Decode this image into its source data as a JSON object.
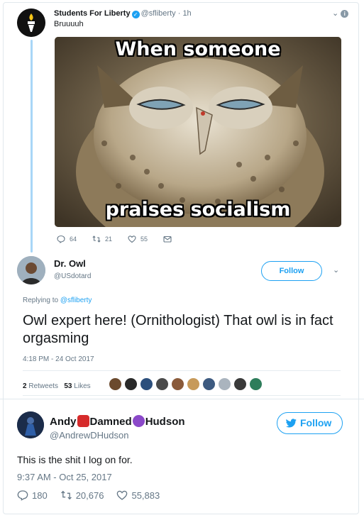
{
  "colors": {
    "accent": "#1da1f2",
    "muted": "#657786",
    "thread_line": "#a8d6f7",
    "text": "#14171a"
  },
  "tweet1": {
    "display_name": "Students For Liberty",
    "handle": "@sfliberty",
    "time_sep": "·",
    "time": "1h",
    "text": "Bruuuuh",
    "meme": {
      "top_caption": "When someone",
      "bottom_caption": "praises socialism"
    },
    "reply_count": "64",
    "retweet_count": "21",
    "like_count": "55",
    "icons": [
      "chevron-down-icon",
      "info-icon",
      "reply-icon",
      "retweet-icon",
      "heart-icon",
      "dm-icon"
    ]
  },
  "reply": {
    "display_name": "Dr. Owl",
    "handle": "@USdotard",
    "follow_label": "Follow",
    "replying_prefix": "Replying to",
    "replying_to": "@sfliberty",
    "text": "Owl expert here!  (Ornithologist) That owl is in fact orgasming",
    "timestamp": "4:18 PM - 24 Oct 2017",
    "retweets_value": "2",
    "retweets_label": "Retweets",
    "likes_value": "53",
    "likes_label": "Likes",
    "liker_colors": [
      "#6b4a2e",
      "#2a2a2a",
      "#2c4f7c",
      "#4a4a4a",
      "#8a5a3a",
      "#c79a5a",
      "#3d5a80",
      "#aab4be",
      "#3a3a3a",
      "#2e7d5b"
    ]
  },
  "tweet2": {
    "name_part1": "Andy",
    "name_part2": "Damned",
    "name_part3": "Hudson",
    "handle": "@AndrewDHudson",
    "follow_label": "Follow",
    "text": "This is the shit I log on for.",
    "timestamp": "9:37 AM - Oct 25, 2017",
    "reply_count": "180",
    "retweet_count": "20,676",
    "like_count": "55,883",
    "icons": [
      "ogre-emoji-icon",
      "devil-emoji-icon",
      "twitter-bird-icon",
      "reply-icon",
      "retweet-icon",
      "heart-icon"
    ]
  }
}
